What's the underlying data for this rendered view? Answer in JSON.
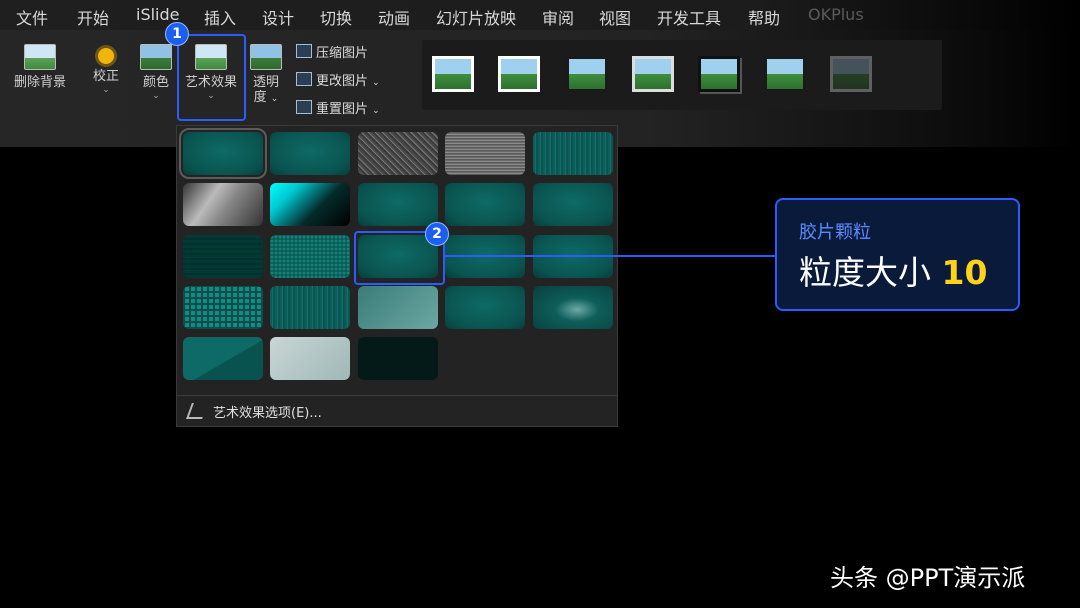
{
  "menu": [
    "文件",
    "开始",
    "iSlide",
    "插入",
    "设计",
    "切换",
    "动画",
    "幻灯片放映",
    "审阅",
    "视图",
    "开发工具",
    "帮助",
    "OKPlus"
  ],
  "ribbon": {
    "remove_bg": "删除背景",
    "correct": "校正",
    "color": "颜色",
    "artistic": "艺术效果",
    "transparency_line1": "透明",
    "transparency_line2": "度",
    "compress": "压缩图片",
    "change": "更改图片",
    "reset": "重置图片"
  },
  "callouts": {
    "step1": "1",
    "step2": "2"
  },
  "gallery": {
    "option_label": "艺术效果选项(E)...",
    "rows": [
      [
        "teal-sel",
        "teal",
        "pencil",
        "noise",
        "tealtex"
      ],
      [
        "silver",
        "glow",
        "teal",
        "teal",
        "teal"
      ],
      [
        "mosaic",
        "dots",
        "teal",
        "teal",
        "teal"
      ],
      [
        "grid",
        "tealtex",
        "pale",
        "teal",
        "blur"
      ],
      [
        "split",
        "light",
        "dark"
      ]
    ]
  },
  "info": {
    "subtitle": "胶片颗粒",
    "main_prefix": "粒度大小 ",
    "main_value": "10"
  },
  "watermark": "头条 @PPT演示派",
  "colors": {
    "accent": "#2a5cff",
    "value": "#ffd21a",
    "tile": "#0e6a66"
  }
}
